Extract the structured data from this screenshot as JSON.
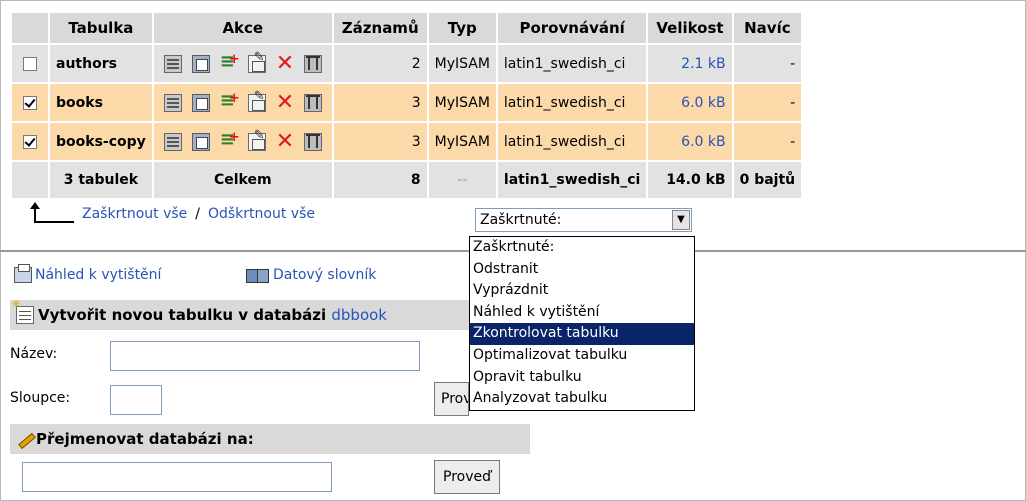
{
  "table": {
    "headers": [
      "Tabulka",
      "Akce",
      "Záznamů",
      "Typ",
      "Porovnávání",
      "Velikost",
      "Navíc"
    ],
    "rows": [
      {
        "name": "authors",
        "checked": false,
        "records": "2",
        "type": "MyISAM",
        "collation": "latin1_swedish_ci",
        "size": "2.1 kB",
        "overhead": "-"
      },
      {
        "name": "books",
        "checked": true,
        "records": "3",
        "type": "MyISAM",
        "collation": "latin1_swedish_ci",
        "size": "6.0 kB",
        "overhead": "-"
      },
      {
        "name": "books-copy",
        "checked": true,
        "records": "3",
        "type": "MyISAM",
        "collation": "latin1_swedish_ci",
        "size": "6.0 kB",
        "overhead": "-"
      }
    ],
    "footer": {
      "tables": "3 tabulek",
      "label": "Celkem",
      "records": "8",
      "type": "--",
      "collation": "latin1_swedish_ci",
      "size": "14.0 kB",
      "overhead": "0 bajtů"
    }
  },
  "action_icons": [
    "browse-icon",
    "structure-icon",
    "search-icon",
    "insert-icon",
    "empty-icon",
    "drop-icon"
  ],
  "checkall": {
    "check_all": "Zaškrtnout vše",
    "separator": "/",
    "uncheck_all": "Odškrtnout vše"
  },
  "with_selected": {
    "current": "Zaškrtnuté:",
    "options": [
      "Zaškrtnuté:",
      "Odstranit",
      "Vyprázdnit",
      "Náhled k vytištění",
      "Zkontrolovat tabulku",
      "Optimalizovat tabulku",
      "Opravit tabulku",
      "Analyzovat tabulku"
    ],
    "highlighted_index": 4
  },
  "links": {
    "print": "Náhled k vytištění",
    "dictionary": "Datový slovník"
  },
  "create_table": {
    "title": "Vytvořit novou tabulku v databázi",
    "database": "dbbook",
    "name_label": "Název:",
    "columns_label": "Sloupce:",
    "name_value": "",
    "columns_value": "",
    "go_button": "Proveď"
  },
  "rename_db": {
    "title": "Přejmenovat databázi na:",
    "value": "",
    "go_button": "Proveď"
  },
  "colors": {
    "marked_row": "#fcd9a8",
    "plain_row": "#e2e2e2",
    "header": "#d9d9d9",
    "link": "#2a53b7",
    "highlight": "#0a246a"
  }
}
